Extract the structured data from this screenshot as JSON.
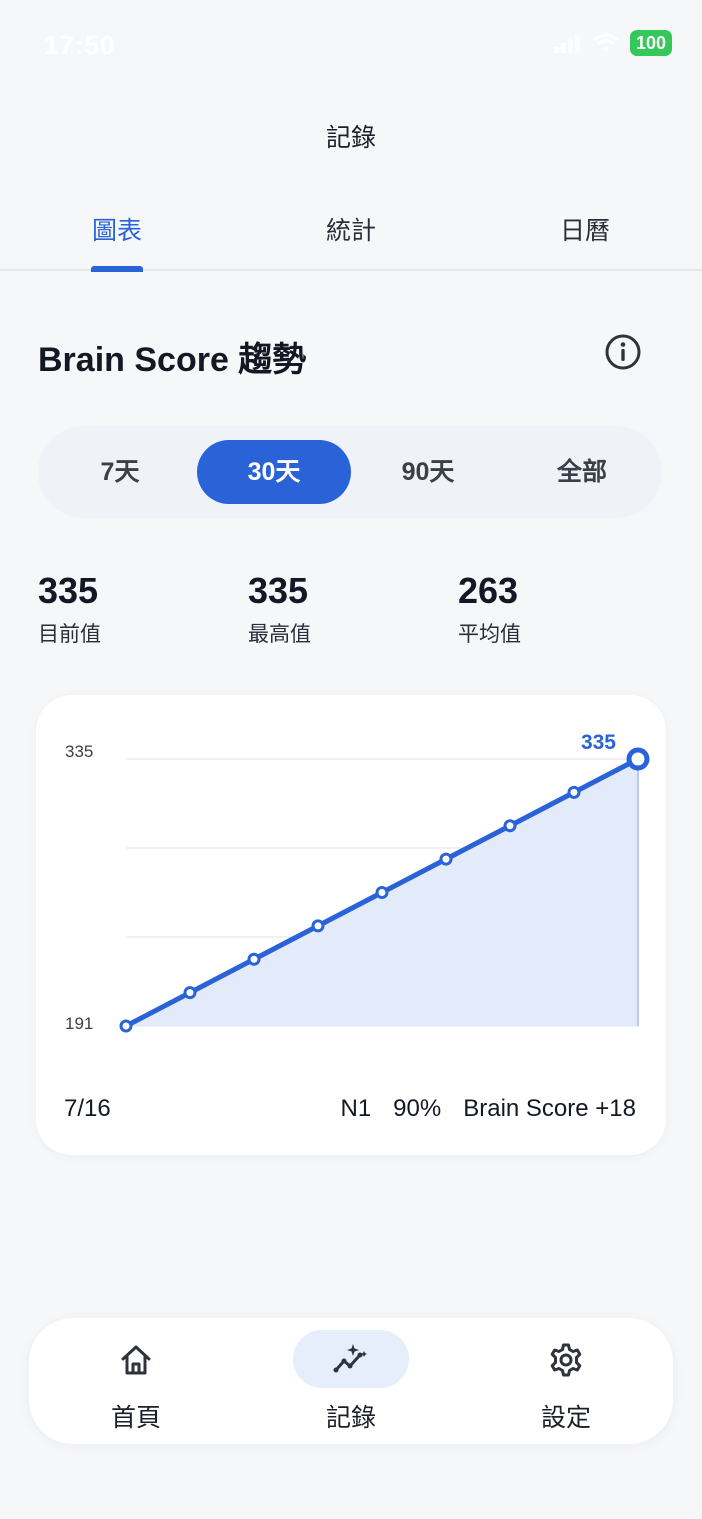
{
  "status_bar": {
    "time": "17:50",
    "battery": "100"
  },
  "header": {
    "title": "記錄"
  },
  "tabs": [
    {
      "label": "圖表",
      "active": true
    },
    {
      "label": "統計",
      "active": false
    },
    {
      "label": "日曆",
      "active": false
    }
  ],
  "section": {
    "title": "Brain Score 趨勢",
    "info_icon": "info-icon"
  },
  "range_selector": [
    {
      "label": "7天",
      "active": false
    },
    {
      "label": "30天",
      "active": true
    },
    {
      "label": "90天",
      "active": false
    },
    {
      "label": "全部",
      "active": false
    }
  ],
  "stats": [
    {
      "value": "335",
      "label": "目前值"
    },
    {
      "value": "335",
      "label": "最高值"
    },
    {
      "value": "263",
      "label": "平均值"
    }
  ],
  "chart_data": {
    "type": "line",
    "x": [
      1,
      2,
      3,
      4,
      5,
      6,
      7,
      8,
      9
    ],
    "values": [
      191,
      209,
      227,
      245,
      263,
      281,
      299,
      317,
      335
    ],
    "ylim": [
      191,
      335
    ],
    "yticks": [
      "335",
      "191"
    ],
    "last_label": "335",
    "grid": true,
    "color": "#2a63d8",
    "fill_color": "#e3eafa"
  },
  "chart_footer": {
    "date": "7/16",
    "level": "N1",
    "accuracy": "90%",
    "score_delta": "Brain Score +18"
  },
  "bottom_nav": [
    {
      "label": "首頁",
      "icon": "home-icon",
      "active": false
    },
    {
      "label": "記錄",
      "icon": "chart-sparkle-icon",
      "active": true
    },
    {
      "label": "設定",
      "icon": "gear-icon",
      "active": false
    }
  ]
}
